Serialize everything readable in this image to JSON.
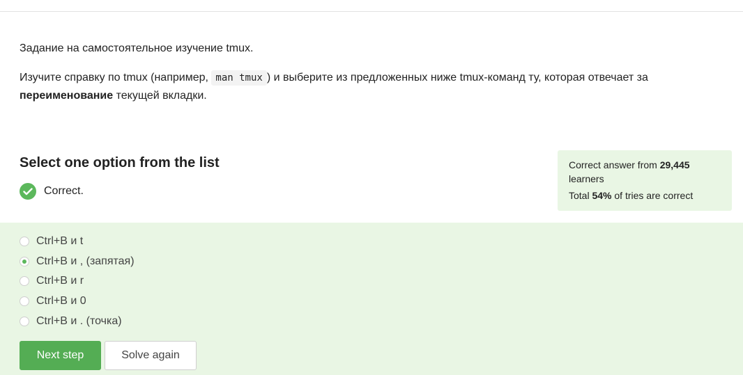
{
  "task": {
    "title": "Задание на самостоятельное изучение tmux.",
    "body_part1": "Изучите справку по tmux (например, ",
    "code": "man tmux",
    "body_part2": ") и выберите из предложенных ниже tmux-команд ту, которая отвечает за ",
    "body_bold": "переименование",
    "body_part3": " текущей вкладки."
  },
  "quiz": {
    "heading": "Select one option from the list",
    "feedback": "Correct.",
    "options": [
      {
        "label": "Ctrl+B и t",
        "selected": false
      },
      {
        "label": "Ctrl+B и , (запятая)",
        "selected": true
      },
      {
        "label": "Ctrl+B и r",
        "selected": false
      },
      {
        "label": "Ctrl+B и 0",
        "selected": false
      },
      {
        "label": "Ctrl+B и . (точка)",
        "selected": false
      }
    ]
  },
  "stats": {
    "line1_prefix": "Correct answer from ",
    "learners_count": "29,445",
    "line1_suffix": " learners",
    "line2_prefix": "Total ",
    "percent": "54%",
    "line2_suffix": " of tries are correct"
  },
  "buttons": {
    "next_label": "Next step",
    "solve_again_label": "Solve again"
  },
  "colors": {
    "accent_green": "#54ad54",
    "success_bg": "#e9f6e4",
    "check_green": "#5cb85c"
  },
  "icons": {
    "feedback": "check-circle-icon",
    "option": "radio-icon"
  }
}
